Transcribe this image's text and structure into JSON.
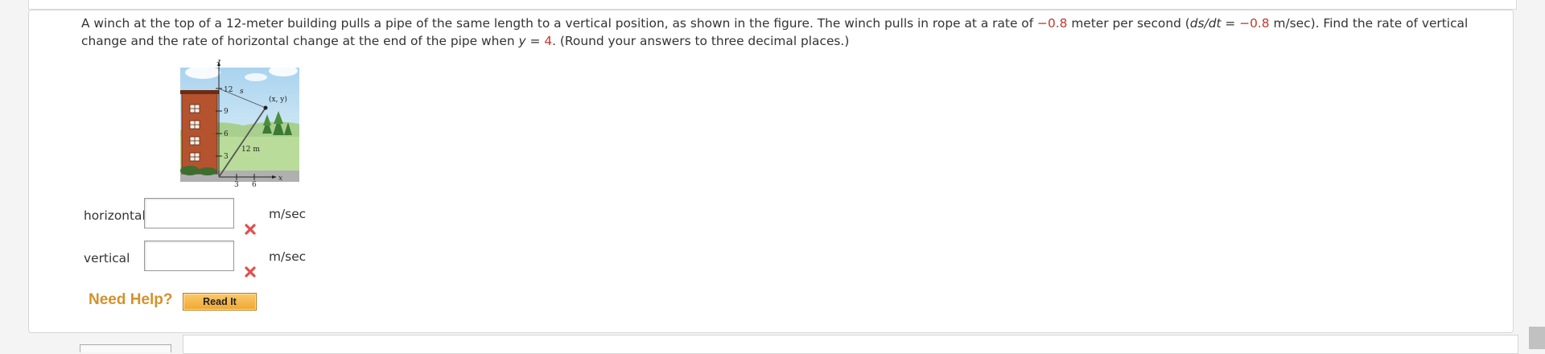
{
  "question": {
    "part1": "A winch at the top of a 12-meter building pulls a pipe of the same length to a vertical position, as shown in the figure. The winch pulls in rope at a rate of ",
    "rate1": "−0.8",
    "part2": " meter per second (",
    "ds_dt": "ds/dt",
    "eq": " = ",
    "rate2": "−0.8",
    "part3": " m/sec). Find the rate of vertical change and the rate of horizontal change at the end of the pipe when ",
    "y_var": "y",
    "eq2": " = ",
    "y_val": "4",
    "part4": ". (Round your answers to three decimal places.)"
  },
  "figure": {
    "y_axis": "y",
    "x_axis": "x",
    "y_ticks": [
      "12",
      "9",
      "6",
      "3"
    ],
    "x_ticks": [
      "3",
      "6"
    ],
    "rope_label": "s",
    "point_label": "(x, y)",
    "pipe_label": "12 m"
  },
  "answers": [
    {
      "label": "horizontal",
      "value": "",
      "unit": "m/sec"
    },
    {
      "label": "vertical",
      "value": "",
      "unit": "m/sec"
    }
  ],
  "help": {
    "need_help": "Need Help?",
    "read_it": "Read It"
  },
  "colors": {
    "accent_red": "#c0392b",
    "help_orange": "#d4922a",
    "button_orange": "#f0a830"
  }
}
